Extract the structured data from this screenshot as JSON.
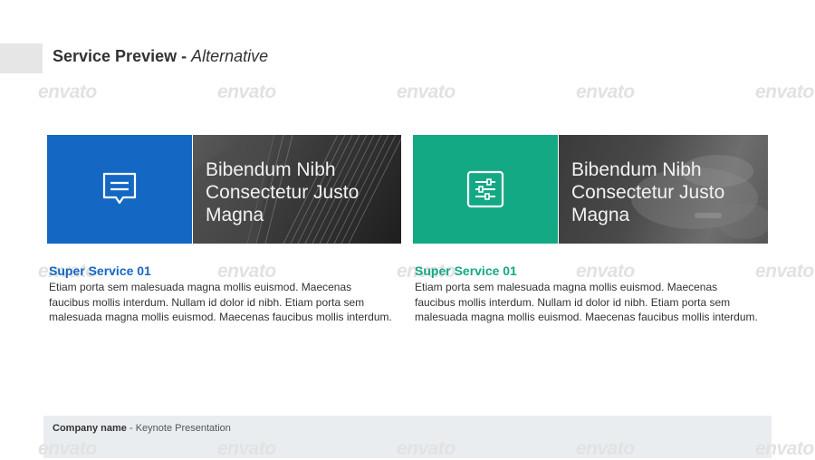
{
  "header": {
    "title": "Service Preview",
    "title_separator": " - ",
    "subtitle": "Alternative"
  },
  "watermark": {
    "text": "envato"
  },
  "services": [
    {
      "banner_text": "Bibendum Nibh Consectetur Justo Magna",
      "title": "Super Service 01",
      "body": "Etiam porta sem malesuada magna mollis euismod. Maecenas faucibus mollis interdum. Nullam id dolor id nibh. Etiam porta sem malesuada magna mollis euismod. Maecenas faucibus mollis interdum.",
      "icon": "chat-bubble-icon",
      "accent": "#1467c3"
    },
    {
      "banner_text": "Bibendum Nibh Consectetur Justo Magna",
      "title": "Super Service 01",
      "body": "Etiam porta sem malesuada magna mollis euismod. Maecenas faucibus mollis interdum. Nullam id dolor id nibh. Etiam porta sem malesuada magna mollis euismod. Maecenas faucibus mollis interdum.",
      "icon": "sliders-icon",
      "accent": "#13a984"
    }
  ],
  "footer": {
    "company": "Company name",
    "separator": " - ",
    "presentation": "Keynote Presentation"
  }
}
